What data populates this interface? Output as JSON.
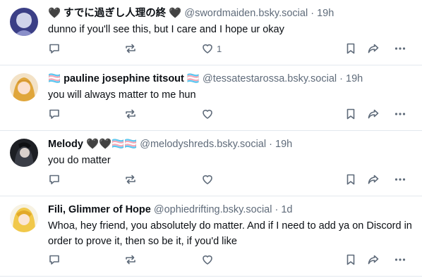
{
  "posts": [
    {
      "name": "🖤 すでに過ぎし人理の終 🖤",
      "handle": "@swordmaiden.bsky.social",
      "time": "19h",
      "text": "dunno if you'll see this, but I care and I hope ur okay",
      "like_count": "1"
    },
    {
      "name": "🏳️‍⚧️ pauline josephine titsout 🏳️‍⚧️",
      "handle": "@tessatestarossa.bsky.social",
      "time": "19h",
      "text": "you will always matter to me hun",
      "like_count": ""
    },
    {
      "name": "Melody 🖤🖤🏳️‍⚧️🏳️‍⚧️",
      "handle": "@melodyshreds.bsky.social",
      "time": "19h",
      "text": "you do matter",
      "like_count": ""
    },
    {
      "name": "Fili, Glimmer of Hope",
      "handle": "@ophiedrifting.bsky.social",
      "time": "1d",
      "text": "Whoa, hey friend, you absolutely do matter. And if I need to add ya on Discord in order to prove it, then so be it, if you'd like",
      "like_count": ""
    }
  ],
  "separator": "·",
  "colors": {
    "text": "#0b0f14",
    "muted": "#5f6b7a",
    "divider": "#e3e8ee"
  },
  "icons": [
    "reply-icon",
    "repost-icon",
    "like-icon",
    "bookmark-icon",
    "share-icon",
    "more-icon"
  ]
}
